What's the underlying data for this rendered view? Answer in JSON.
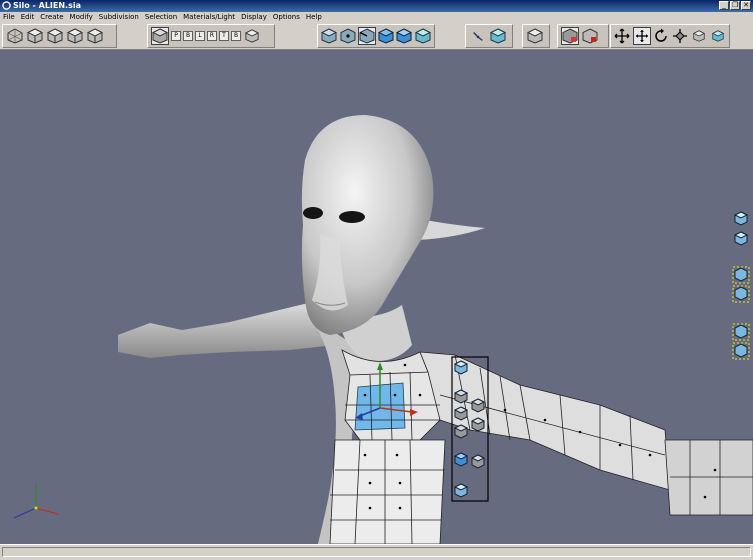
{
  "window": {
    "title": "Silo  - ALIEN.sia",
    "buttons": [
      "_",
      "❒",
      "✕"
    ]
  },
  "menu": [
    "File",
    "Edit",
    "Create",
    "Modify",
    "Subdivision",
    "Selection",
    "Materials/Light",
    "Display",
    "Options",
    "Help"
  ],
  "toolbar": {
    "view_buttons": [
      "perspective-view-icon",
      "cube-view-icon",
      "cube-view-icon",
      "cube-view-icon",
      "cube-view-icon"
    ],
    "ortho_letters": [
      "P",
      "B",
      "L",
      "R",
      "T",
      "B"
    ],
    "selection_modes": [
      "object-mode-icon",
      "vertex-mode-icon",
      "edge-mode-icon",
      "face-mode-icon",
      "multi-mode-icon",
      "cube-mode-icon"
    ],
    "transform_tools": [
      "move-icon",
      "move-icon",
      "rotate-icon",
      "scale-icon",
      "cube-icon",
      "cube-icon"
    ]
  },
  "colors": {
    "viewport_bg": "#676b80",
    "selection_blue": "#6fb8e8",
    "titlebar": "#0a246a"
  }
}
